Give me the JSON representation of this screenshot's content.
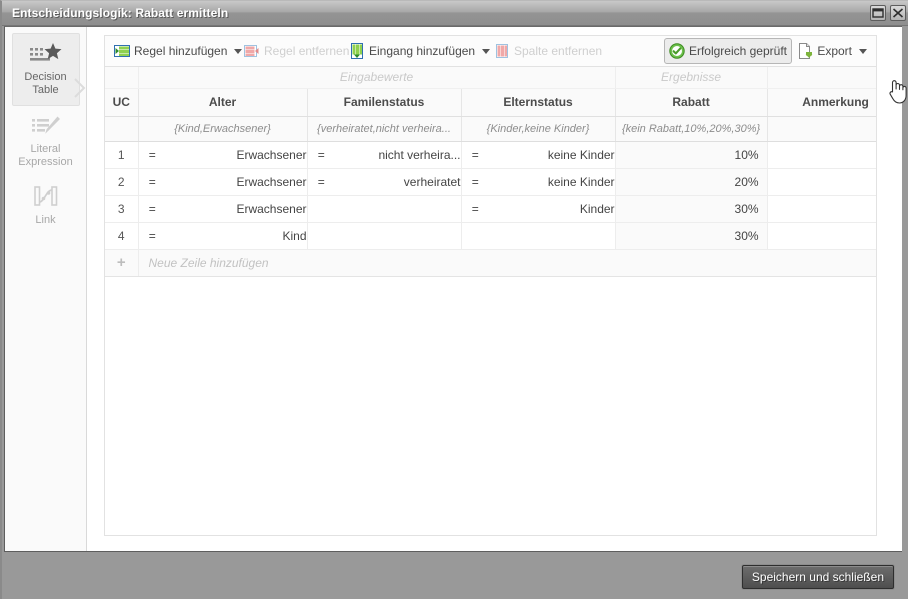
{
  "window": {
    "title": "Entscheidungslogik: Rabatt ermitteln",
    "maximize_icon": "maximize-icon",
    "close_icon": "close-icon"
  },
  "sidebar": {
    "items": [
      {
        "label_line1": "Decision",
        "label_line2": "Table",
        "icon": "decision-table-icon",
        "active": true
      },
      {
        "label_line1": "Literal",
        "label_line2": "Expression",
        "icon": "literal-expression-icon",
        "active": false
      },
      {
        "label_line1": "Link",
        "label_line2": "",
        "icon": "link-icon",
        "active": false
      }
    ]
  },
  "toolbar": {
    "add_rule": {
      "label": "Regel hinzufügen",
      "icon": "add-rule-icon",
      "has_caret": true,
      "disabled": false
    },
    "remove_rule": {
      "label": "Regel entfernen",
      "icon": "remove-rule-icon",
      "has_caret": false,
      "disabled": true
    },
    "add_input": {
      "label": "Eingang hinzufügen",
      "icon": "add-input-icon",
      "has_caret": true,
      "disabled": false
    },
    "remove_column": {
      "label": "Spalte entfernen",
      "icon": "remove-column-icon",
      "has_caret": false,
      "disabled": true
    },
    "validated": {
      "label": "Erfolgreich geprüft",
      "icon": "check-circle-icon",
      "has_caret": false,
      "pressed": true
    },
    "export": {
      "label": "Export",
      "icon": "export-icon",
      "has_caret": true,
      "disabled": false
    }
  },
  "table": {
    "group_headers": {
      "inputs": "Eingabewerte",
      "outputs": "Ergebnisse"
    },
    "columns": [
      {
        "label": "UC"
      },
      {
        "label": "Alter"
      },
      {
        "label": "Familenstatus"
      },
      {
        "label": "Elternstatus"
      },
      {
        "label": "Rabatt"
      },
      {
        "label": "Anmerkung"
      }
    ],
    "domains": {
      "alter": "{Kind,Erwachsener}",
      "familienstatus": "{verheiratet,nicht verheira...",
      "elternstatus": "{Kinder,keine Kinder}",
      "rabatt": "{kein Rabatt,10%,20%,30%}",
      "anmerkung": ""
    },
    "rows": [
      {
        "index": "1",
        "alter_op": "=",
        "alter_val": "Erwachsener",
        "familienstatus_op": "=",
        "familienstatus_val": "nicht verheira...",
        "elternstatus_op": "=",
        "elternstatus_val": "keine Kinder",
        "rabatt": "10%",
        "anmerkung": ""
      },
      {
        "index": "2",
        "alter_op": "=",
        "alter_val": "Erwachsener",
        "familienstatus_op": "=",
        "familienstatus_val": "verheiratet",
        "elternstatus_op": "=",
        "elternstatus_val": "keine Kinder",
        "rabatt": "20%",
        "anmerkung": ""
      },
      {
        "index": "3",
        "alter_op": "=",
        "alter_val": "Erwachsener",
        "familienstatus_op": "",
        "familienstatus_val": "",
        "elternstatus_op": "=",
        "elternstatus_val": "Kinder",
        "rabatt": "30%",
        "anmerkung": ""
      },
      {
        "index": "4",
        "alter_op": "=",
        "alter_val": "Kind",
        "familienstatus_op": "",
        "familienstatus_val": "",
        "elternstatus_op": "",
        "elternstatus_val": "",
        "rabatt": "30%",
        "anmerkung": ""
      }
    ],
    "add_row": {
      "plus": "+",
      "label": "Neue Zeile hinzufügen"
    }
  },
  "footer": {
    "save_label": "Speichern und schließen"
  },
  "colors": {
    "accent_green": "#5aa02c",
    "title_bar": "#9a9a9a",
    "table_header_bg": "#fafafa",
    "result_cell_bg": "#fafafa",
    "disabled_text": "#cfcfcf"
  }
}
